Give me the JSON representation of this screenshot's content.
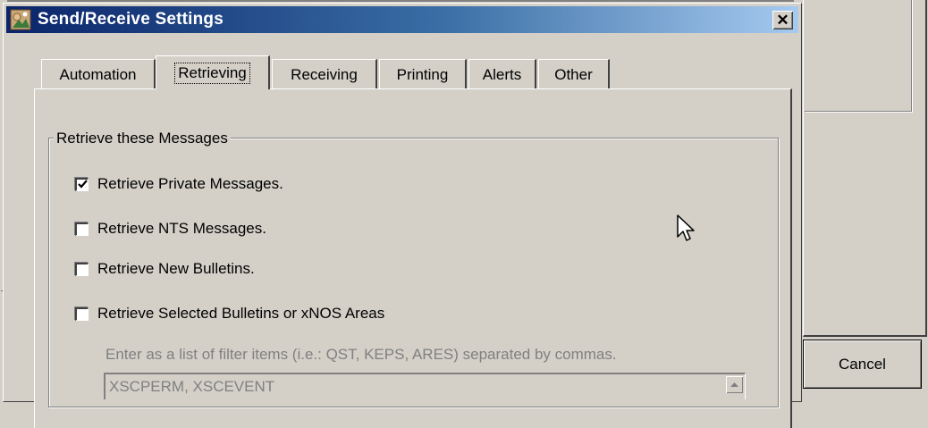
{
  "dialog": {
    "title": "Send/Receive Settings",
    "close_glyph": "✕"
  },
  "tabs": [
    {
      "label": "Automation",
      "selected": false
    },
    {
      "label": "Retrieving",
      "selected": true
    },
    {
      "label": "Receiving",
      "selected": false
    },
    {
      "label": "Printing",
      "selected": false
    },
    {
      "label": "Alerts",
      "selected": false
    },
    {
      "label": "Other",
      "selected": false
    }
  ],
  "group": {
    "title": "Retrieve these Messages",
    "checkboxes": [
      {
        "label": "Retrieve Private Messages.",
        "checked": true
      },
      {
        "label": "Retrieve NTS Messages.",
        "checked": false
      },
      {
        "label": "Retrieve New Bulletins.",
        "checked": false
      },
      {
        "label": "Retrieve Selected Bulletins or xNOS Areas",
        "checked": false
      }
    ],
    "hint": "Enter as a list of filter items (i.e.: QST, KEPS, ARES) separated by commas.",
    "filter_value": "XSCPERM, XSCEVENT"
  },
  "background": {
    "cancel_label": "Cancel",
    "arrow_glyph": "→"
  },
  "colors": {
    "face": "#d4d0c8",
    "title_start": "#0a246a",
    "title_end": "#a6caf0",
    "disabled_text": "#808080"
  }
}
